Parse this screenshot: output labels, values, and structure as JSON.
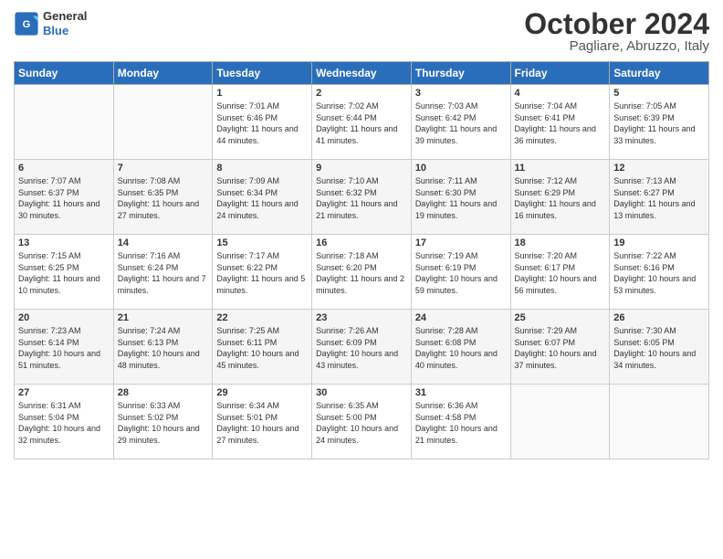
{
  "header": {
    "logo_line1": "General",
    "logo_line2": "Blue",
    "month": "October 2024",
    "location": "Pagliare, Abruzzo, Italy"
  },
  "days_of_week": [
    "Sunday",
    "Monday",
    "Tuesday",
    "Wednesday",
    "Thursday",
    "Friday",
    "Saturday"
  ],
  "weeks": [
    [
      {
        "day": "",
        "info": ""
      },
      {
        "day": "",
        "info": ""
      },
      {
        "day": "1",
        "info": "Sunrise: 7:01 AM\nSunset: 6:46 PM\nDaylight: 11 hours and 44 minutes."
      },
      {
        "day": "2",
        "info": "Sunrise: 7:02 AM\nSunset: 6:44 PM\nDaylight: 11 hours and 41 minutes."
      },
      {
        "day": "3",
        "info": "Sunrise: 7:03 AM\nSunset: 6:42 PM\nDaylight: 11 hours and 39 minutes."
      },
      {
        "day": "4",
        "info": "Sunrise: 7:04 AM\nSunset: 6:41 PM\nDaylight: 11 hours and 36 minutes."
      },
      {
        "day": "5",
        "info": "Sunrise: 7:05 AM\nSunset: 6:39 PM\nDaylight: 11 hours and 33 minutes."
      }
    ],
    [
      {
        "day": "6",
        "info": "Sunrise: 7:07 AM\nSunset: 6:37 PM\nDaylight: 11 hours and 30 minutes."
      },
      {
        "day": "7",
        "info": "Sunrise: 7:08 AM\nSunset: 6:35 PM\nDaylight: 11 hours and 27 minutes."
      },
      {
        "day": "8",
        "info": "Sunrise: 7:09 AM\nSunset: 6:34 PM\nDaylight: 11 hours and 24 minutes."
      },
      {
        "day": "9",
        "info": "Sunrise: 7:10 AM\nSunset: 6:32 PM\nDaylight: 11 hours and 21 minutes."
      },
      {
        "day": "10",
        "info": "Sunrise: 7:11 AM\nSunset: 6:30 PM\nDaylight: 11 hours and 19 minutes."
      },
      {
        "day": "11",
        "info": "Sunrise: 7:12 AM\nSunset: 6:29 PM\nDaylight: 11 hours and 16 minutes."
      },
      {
        "day": "12",
        "info": "Sunrise: 7:13 AM\nSunset: 6:27 PM\nDaylight: 11 hours and 13 minutes."
      }
    ],
    [
      {
        "day": "13",
        "info": "Sunrise: 7:15 AM\nSunset: 6:25 PM\nDaylight: 11 hours and 10 minutes."
      },
      {
        "day": "14",
        "info": "Sunrise: 7:16 AM\nSunset: 6:24 PM\nDaylight: 11 hours and 7 minutes."
      },
      {
        "day": "15",
        "info": "Sunrise: 7:17 AM\nSunset: 6:22 PM\nDaylight: 11 hours and 5 minutes."
      },
      {
        "day": "16",
        "info": "Sunrise: 7:18 AM\nSunset: 6:20 PM\nDaylight: 11 hours and 2 minutes."
      },
      {
        "day": "17",
        "info": "Sunrise: 7:19 AM\nSunset: 6:19 PM\nDaylight: 10 hours and 59 minutes."
      },
      {
        "day": "18",
        "info": "Sunrise: 7:20 AM\nSunset: 6:17 PM\nDaylight: 10 hours and 56 minutes."
      },
      {
        "day": "19",
        "info": "Sunrise: 7:22 AM\nSunset: 6:16 PM\nDaylight: 10 hours and 53 minutes."
      }
    ],
    [
      {
        "day": "20",
        "info": "Sunrise: 7:23 AM\nSunset: 6:14 PM\nDaylight: 10 hours and 51 minutes."
      },
      {
        "day": "21",
        "info": "Sunrise: 7:24 AM\nSunset: 6:13 PM\nDaylight: 10 hours and 48 minutes."
      },
      {
        "day": "22",
        "info": "Sunrise: 7:25 AM\nSunset: 6:11 PM\nDaylight: 10 hours and 45 minutes."
      },
      {
        "day": "23",
        "info": "Sunrise: 7:26 AM\nSunset: 6:09 PM\nDaylight: 10 hours and 43 minutes."
      },
      {
        "day": "24",
        "info": "Sunrise: 7:28 AM\nSunset: 6:08 PM\nDaylight: 10 hours and 40 minutes."
      },
      {
        "day": "25",
        "info": "Sunrise: 7:29 AM\nSunset: 6:07 PM\nDaylight: 10 hours and 37 minutes."
      },
      {
        "day": "26",
        "info": "Sunrise: 7:30 AM\nSunset: 6:05 PM\nDaylight: 10 hours and 34 minutes."
      }
    ],
    [
      {
        "day": "27",
        "info": "Sunrise: 6:31 AM\nSunset: 5:04 PM\nDaylight: 10 hours and 32 minutes."
      },
      {
        "day": "28",
        "info": "Sunrise: 6:33 AM\nSunset: 5:02 PM\nDaylight: 10 hours and 29 minutes."
      },
      {
        "day": "29",
        "info": "Sunrise: 6:34 AM\nSunset: 5:01 PM\nDaylight: 10 hours and 27 minutes."
      },
      {
        "day": "30",
        "info": "Sunrise: 6:35 AM\nSunset: 5:00 PM\nDaylight: 10 hours and 24 minutes."
      },
      {
        "day": "31",
        "info": "Sunrise: 6:36 AM\nSunset: 4:58 PM\nDaylight: 10 hours and 21 minutes."
      },
      {
        "day": "",
        "info": ""
      },
      {
        "day": "",
        "info": ""
      }
    ]
  ]
}
